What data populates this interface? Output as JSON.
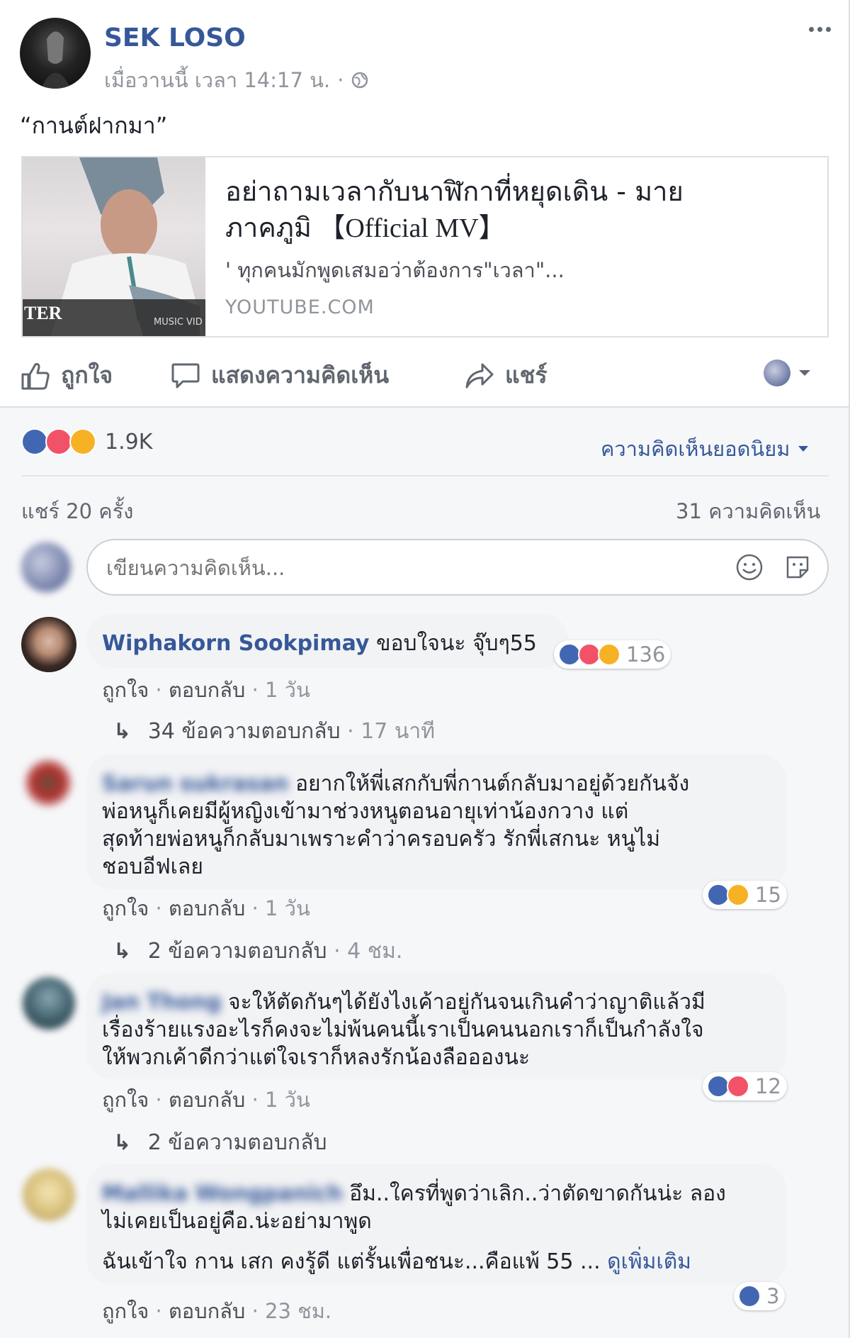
{
  "post": {
    "author": "SEK LOSO",
    "timestamp": "เมื่อวานนี้ เวลา 14:17 น.",
    "separator": "·",
    "text": "“กานต์ฝากมา”",
    "more_icon": "more-dots-icon",
    "privacy_icon": "globe-icon"
  },
  "link": {
    "title_line1": "อย่าถามเวลากับนาฬิกาที่หยุดเดิน - มาย",
    "title_line2": "ภาคภูมิ 【Official MV】",
    "description": "' ทุกคนมักพูดเสมอว่าต้องการ\"เวลา\"...",
    "domain": "YOUTUBE.COM",
    "thumb_caption_left": "TER",
    "thumb_caption_right": "MUSIC VID"
  },
  "actions": {
    "like": "ถูกใจ",
    "comment": "แสดงความคิดเห็น",
    "share": "แชร์"
  },
  "summary": {
    "reaction_count": "1.9K",
    "sort_label": "ความคิดเห็นยอดนิยม",
    "shares": "แชร์ 20 ครั้ง",
    "comments": "31 ความคิดเห็น"
  },
  "composer": {
    "placeholder": "เขียนความคิดเห็น..."
  },
  "meta_labels": {
    "like": "ถูกใจ",
    "reply": "ตอบกลับ",
    "dot": "·"
  },
  "comments": [
    {
      "name": "Wiphakorn Sookpimay",
      "text": "ขอบใจนะ จุ๊บๆ55",
      "age": "1 วัน",
      "reactions": "136",
      "replies": "34 ข้อความตอบกลับ",
      "replies_age": "· 17 นาที"
    },
    {
      "name": "Sarun sukrasan",
      "line1": "อยากให้พี่เสกกับพี่กานต์กลับมาอยู่ด้วยกันจัง",
      "line2": "พ่อหนูก็เคยมีผู้หญิงเข้ามาช่วงหนูตอนอายุเท่าน้องกวาง แต่",
      "line3": "สุดท้ายพ่อหนูก็กลับมาเพราะคำว่าครอบครัว รักพี่เสกนะ หนูไม่",
      "line4": "ชอบอีฟเลย",
      "age": "1 วัน",
      "reactions": "15",
      "replies": "2 ข้อความตอบกลับ",
      "replies_age": "· 4 ชม."
    },
    {
      "name": "Jan Thong",
      "line1": "จะให้ตัดกันๆได้ยังไงเค้าอยู่กันจนเกินคำว่าญาติแล้วมี",
      "line2": "เรื่องร้ายแรงอะไรก็คงจะไม่พ้นคนนี้เราเป็นคนนอกเราก็เป็นกำลังใจ",
      "line3": "ให้พวกเค้าดีกว่าแต่ใจเราก็หลงรักน้องลืออองนะ",
      "age": "1 วัน",
      "reactions": "12",
      "replies": "2 ข้อความตอบกลับ"
    },
    {
      "name": "Mallika Wongpanich",
      "line1": "อึม..ใครที่พูดว่าเลิก..ว่าตัดขาดกันน่ะ ลอง",
      "line2": "ไม่เคยเป็นอยู่คือ.น่ะอย่ามาพูด",
      "line3": "ฉันเข้าใจ กาน เสก คงรู้ดี แต่รั้นเพื่อชนะ...คือแพ้ 55 ...",
      "see_more": "ดูเพิ่มเติม",
      "age": "23 ชม.",
      "reactions": "3"
    }
  ],
  "colors": {
    "link": "#365899",
    "muted": "#90949c",
    "like": "#4267b2",
    "love": "#f25268",
    "haha": "#f7b125"
  }
}
